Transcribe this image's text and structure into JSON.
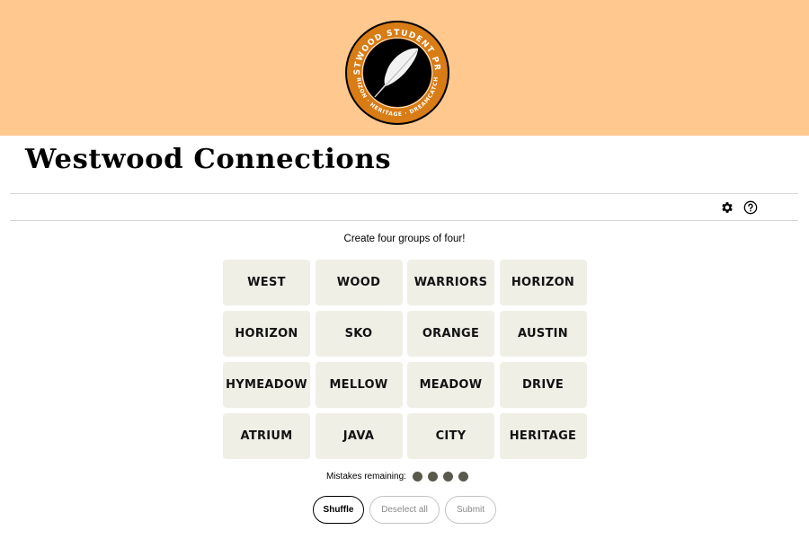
{
  "header": {
    "background_color": "#fec88f",
    "logo": {
      "top_text": "WESTWOOD STUDENT PRESS",
      "bottom_text": "HORIZON · HERITAGE · DREAMCATCHER",
      "ring_color": "#d87c16",
      "inner_color": "#000000",
      "icon": "feather-quill-icon"
    }
  },
  "page": {
    "title": "Westwood Connections"
  },
  "toolbar": {
    "icons": [
      {
        "name": "gear-icon",
        "label": "Settings"
      },
      {
        "name": "help-icon",
        "label": "Help"
      }
    ]
  },
  "game": {
    "instructions": "Create four groups of four!",
    "tiles": [
      "WEST",
      "WOOD",
      "WARRIORS",
      "HORIZON",
      "HORIZON",
      "SKO",
      "ORANGE",
      "AUSTIN",
      "HYMEADOW",
      "MELLOW",
      "MEADOW",
      "DRIVE",
      "ATRIUM",
      "JAVA",
      "CITY",
      "HERITAGE"
    ],
    "tile_color": "#efefe6",
    "mistakes_label": "Mistakes remaining:",
    "mistakes_remaining": 4,
    "mistake_dot_color": "#5a594e",
    "buttons": {
      "shuffle": "Shuffle",
      "deselect_all": "Deselect all",
      "submit": "Submit"
    }
  }
}
